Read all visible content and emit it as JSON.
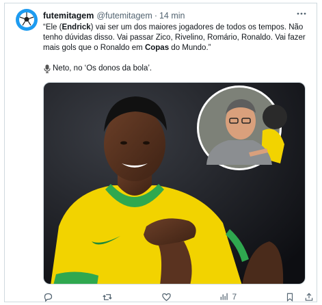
{
  "tweet": {
    "display_name": "futemitagem",
    "handle": "@futemitagem",
    "separator": "·",
    "time": "14 min",
    "quote_part1": "“Ele (",
    "quote_bold1": "Endrick",
    "quote_part2": ") vai ser um dos maiores jogadores de todos os tempos. Não tenho dúvidas disso. Vai passar Zico, Rivelino, Romário, Ronaldo. Vai fazer mais gols que o Ronaldo em ",
    "quote_bold2": "Copas",
    "quote_part3": " do Mundo.”",
    "credit": "Neto, no ‘Os donos da bola’.",
    "views": "7"
  },
  "icons": {
    "avatar": "soccer-ball-icon",
    "more": "more-icon",
    "mic": "microphone-icon",
    "reply": "reply-icon",
    "retweet": "retweet-icon",
    "like": "heart-icon",
    "views": "bar-chart-icon",
    "bookmark": "bookmark-icon",
    "share": "share-icon"
  },
  "colors": {
    "text": "#0f1419",
    "muted": "#536471",
    "accent": "#1d9bf0",
    "shirt_yellow": "#f2d300",
    "collar_green": "#2fa84f"
  }
}
